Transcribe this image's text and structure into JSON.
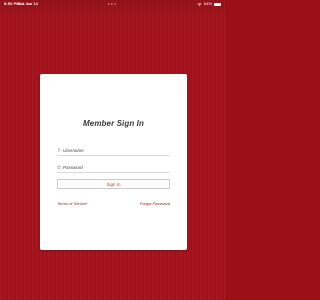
{
  "status_bar": {
    "time": "8:50 PM",
    "date": "Sat Jan 14",
    "center_dots": "• • •",
    "battery_percent": "64%",
    "battery_level": 0.64
  },
  "login": {
    "title": "Member Sign In",
    "username_placeholder": "Username",
    "password_placeholder": "Password",
    "signin_label": "Sign In",
    "terms_label": "Terms of Service",
    "forgot_label": "Forgot Password"
  },
  "colors": {
    "background": "#a3121b",
    "card": "#ffffff",
    "link": "#8a1a1f",
    "signin_text": "#c0392b"
  },
  "icons": {
    "user_field": "user-icon",
    "password_field": "lock-icon",
    "wifi": "wifi-icon",
    "battery": "battery-icon"
  }
}
